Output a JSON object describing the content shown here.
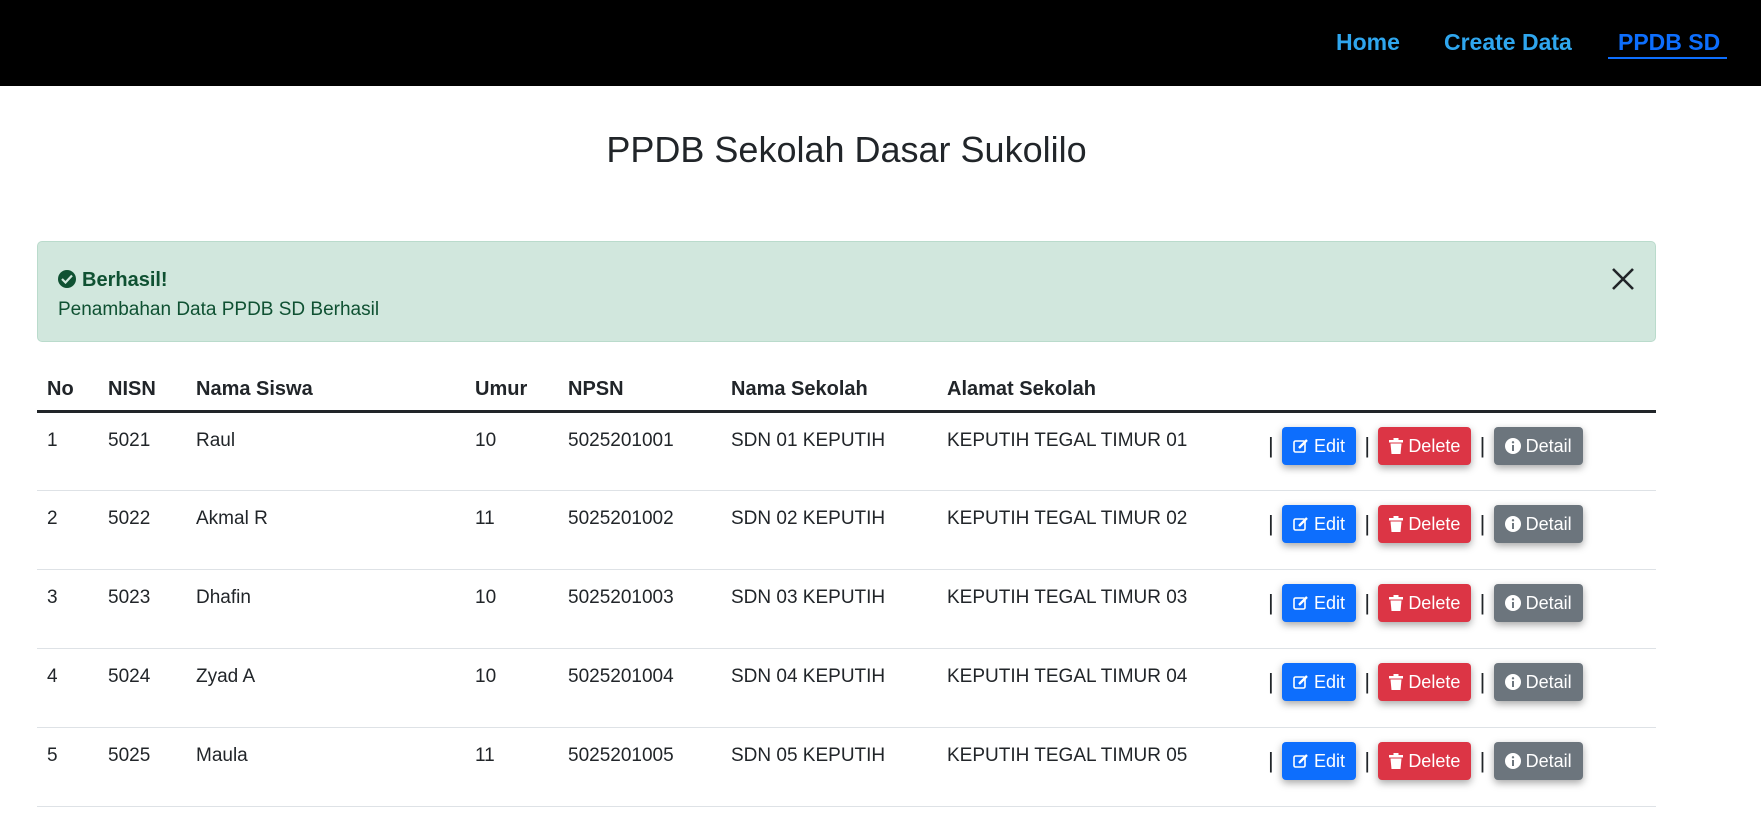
{
  "nav": {
    "home": "Home",
    "create": "Create Data",
    "ppdb": "PPDB SD"
  },
  "page": {
    "title": "PPDB Sekolah Dasar Sukolilo"
  },
  "alert": {
    "title": "Berhasil!",
    "message": "Penambahan Data PPDB SD Berhasil",
    "close_icon": "close-icon",
    "status_color": "#d1e7dd"
  },
  "table": {
    "headers": [
      "No",
      "NISN",
      "Nama Siswa",
      "Umur",
      "NPSN",
      "Nama Sekolah",
      "Alamat Sekolah"
    ],
    "rows": [
      {
        "no": "1",
        "nisn": "5021",
        "nama": "Raul",
        "umur": "10",
        "npsn": "5025201001",
        "sekolah": "SDN 01 KEPUTIH",
        "alamat": "KEPUTIH TEGAL TIMUR 01"
      },
      {
        "no": "2",
        "nisn": "5022",
        "nama": "Akmal R",
        "umur": "11",
        "npsn": "5025201002",
        "sekolah": "SDN 02 KEPUTIH",
        "alamat": "KEPUTIH TEGAL TIMUR 02"
      },
      {
        "no": "3",
        "nisn": "5023",
        "nama": "Dhafin",
        "umur": "10",
        "npsn": "5025201003",
        "sekolah": "SDN 03 KEPUTIH",
        "alamat": "KEPUTIH TEGAL TIMUR 03"
      },
      {
        "no": "4",
        "nisn": "5024",
        "nama": "Zyad A",
        "umur": "10",
        "npsn": "5025201004",
        "sekolah": "SDN 04 KEPUTIH",
        "alamat": "KEPUTIH TEGAL TIMUR 04"
      },
      {
        "no": "5",
        "nisn": "5025",
        "nama": "Maula",
        "umur": "11",
        "npsn": "5025201005",
        "sekolah": "SDN 05 KEPUTIH",
        "alamat": "KEPUTIH TEGAL TIMUR 05"
      }
    ]
  },
  "actions": {
    "separator": "|",
    "edit": "Edit",
    "delete": "Delete",
    "detail": "Detail"
  },
  "colors": {
    "nav_link": "#2fa6ee",
    "nav_active": "#0d6efd",
    "edit": "#0d6efd",
    "delete": "#dc3545",
    "detail": "#6c757d"
  }
}
